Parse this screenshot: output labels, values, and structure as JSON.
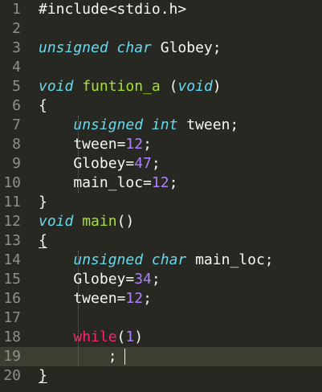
{
  "editor": {
    "lines": [
      {
        "num": "1",
        "tokens": [
          {
            "t": "#include<stdio.h>",
            "k": "plain"
          }
        ]
      },
      {
        "num": "2",
        "tokens": []
      },
      {
        "num": "3",
        "tokens": [
          {
            "t": "unsigned char",
            "k": "type"
          },
          {
            "t": " Globey;",
            "k": "plain"
          }
        ]
      },
      {
        "num": "4",
        "tokens": []
      },
      {
        "num": "5",
        "tokens": [
          {
            "t": "void",
            "k": "type"
          },
          {
            "t": " ",
            "k": "plain"
          },
          {
            "t": "funtion_a",
            "k": "fn"
          },
          {
            "t": " (",
            "k": "plain"
          },
          {
            "t": "void",
            "k": "type"
          },
          {
            "t": ")",
            "k": "plain"
          }
        ]
      },
      {
        "num": "6",
        "tokens": [
          {
            "t": "{",
            "k": "plain"
          }
        ]
      },
      {
        "num": "7",
        "tokens": [
          {
            "t": "    ",
            "k": "plain"
          },
          {
            "t": "unsigned int",
            "k": "type"
          },
          {
            "t": " tween;",
            "k": "plain"
          }
        ]
      },
      {
        "num": "8",
        "tokens": [
          {
            "t": "    tween=",
            "k": "plain"
          },
          {
            "t": "12",
            "k": "num"
          },
          {
            "t": ";",
            "k": "plain"
          }
        ]
      },
      {
        "num": "9",
        "tokens": [
          {
            "t": "    Globey=",
            "k": "plain"
          },
          {
            "t": "47",
            "k": "num"
          },
          {
            "t": ";",
            "k": "plain"
          }
        ]
      },
      {
        "num": "10",
        "tokens": [
          {
            "t": "    main_loc=",
            "k": "plain"
          },
          {
            "t": "12",
            "k": "num"
          },
          {
            "t": ";",
            "k": "plain"
          }
        ]
      },
      {
        "num": "11",
        "tokens": [
          {
            "t": "}",
            "k": "plain"
          }
        ]
      },
      {
        "num": "12",
        "tokens": [
          {
            "t": "void",
            "k": "type"
          },
          {
            "t": " ",
            "k": "plain"
          },
          {
            "t": "main",
            "k": "fn"
          },
          {
            "t": "()",
            "k": "plain"
          }
        ]
      },
      {
        "num": "13",
        "tokens": [
          {
            "t": "{",
            "k": "plain-ul"
          }
        ]
      },
      {
        "num": "14",
        "tokens": [
          {
            "t": "    ",
            "k": "plain"
          },
          {
            "t": "unsigned char",
            "k": "type"
          },
          {
            "t": " main_loc;",
            "k": "plain"
          }
        ]
      },
      {
        "num": "15",
        "tokens": [
          {
            "t": "    Globey=",
            "k": "plain"
          },
          {
            "t": "34",
            "k": "num"
          },
          {
            "t": ";",
            "k": "plain"
          }
        ]
      },
      {
        "num": "16",
        "tokens": [
          {
            "t": "    tween=",
            "k": "plain"
          },
          {
            "t": "12",
            "k": "num"
          },
          {
            "t": ";",
            "k": "plain"
          }
        ]
      },
      {
        "num": "17",
        "tokens": []
      },
      {
        "num": "18",
        "tokens": [
          {
            "t": "    ",
            "k": "plain"
          },
          {
            "t": "while",
            "k": "kw"
          },
          {
            "t": "(",
            "k": "plain"
          },
          {
            "t": "1",
            "k": "num"
          },
          {
            "t": ")",
            "k": "plain"
          }
        ]
      },
      {
        "num": "19",
        "tokens": [
          {
            "t": "        ;",
            "k": "plain"
          }
        ]
      },
      {
        "num": "20",
        "tokens": [
          {
            "t": "}",
            "k": "plain-ul"
          }
        ]
      }
    ],
    "active_line": 19,
    "theme": {
      "background": "#272822",
      "active_line": "#3e3d32",
      "gutter_text": "#8f908a",
      "plain": "#f8f8f2",
      "type": "#66d9ef",
      "function": "#a6e22e",
      "number": "#ae81ff",
      "keyword": "#f92672"
    }
  }
}
